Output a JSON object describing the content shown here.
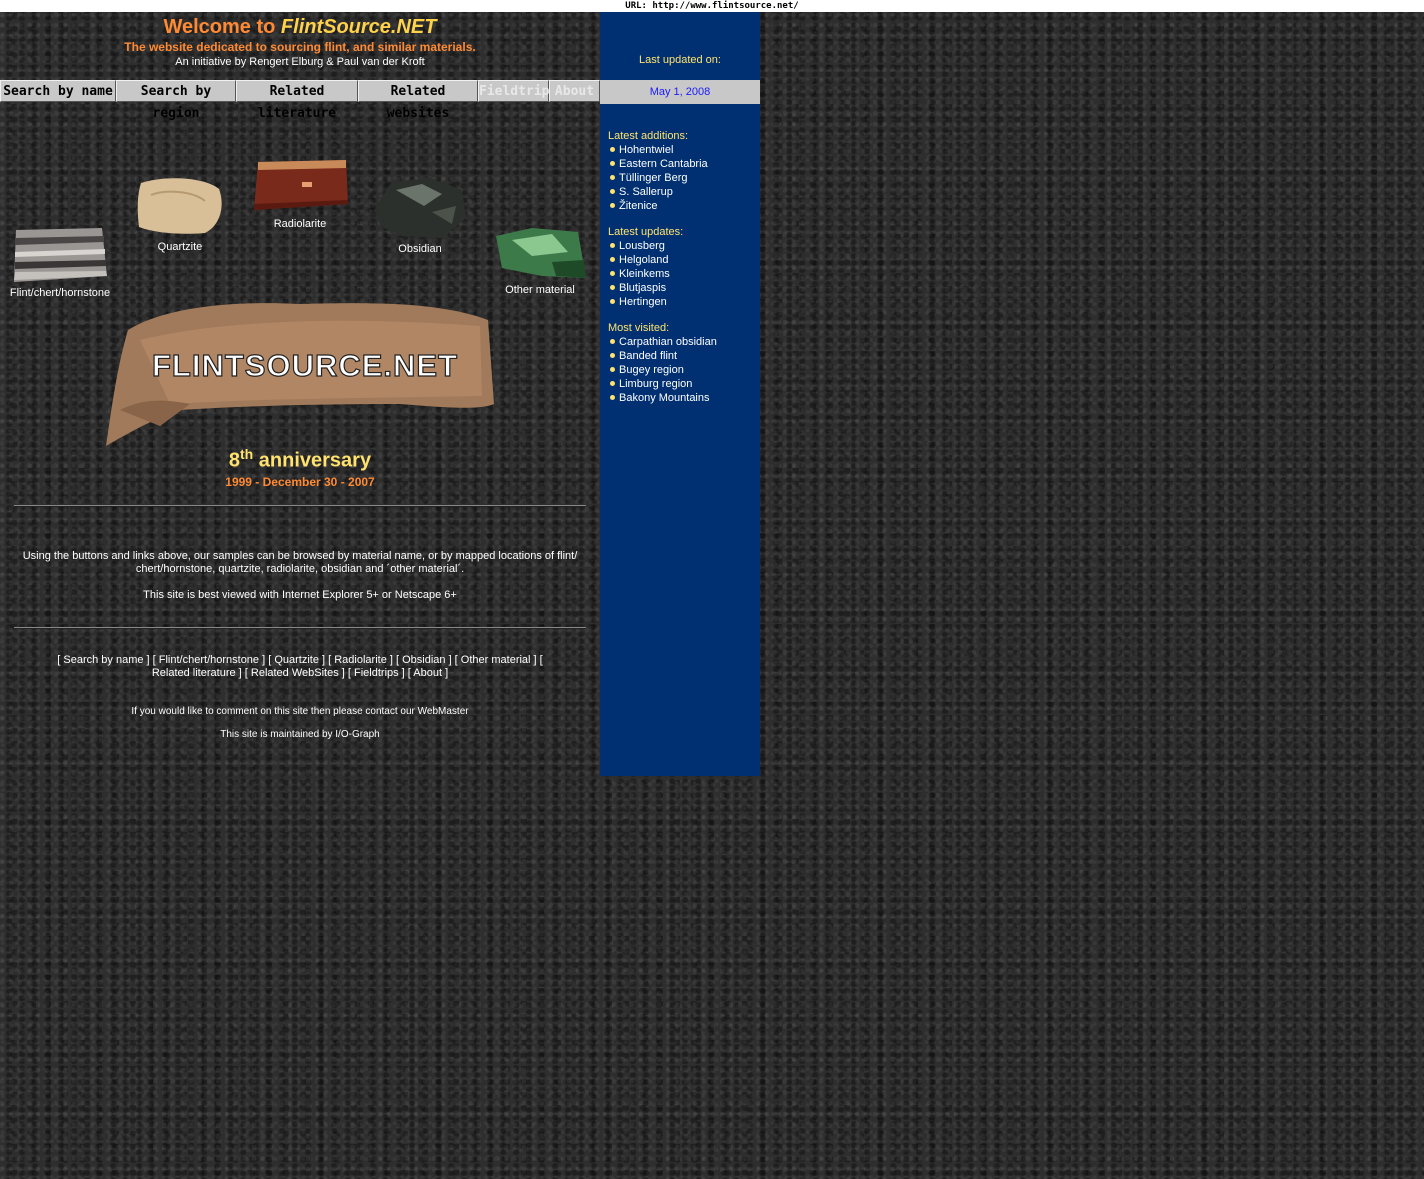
{
  "url_bar": "URL: http://www.flintsource.net/",
  "header": {
    "welcome_prefix": "Welcome to ",
    "welcome_brand": "FlintSource.NET",
    "subtitle": "The website dedicated to sourcing flint, and similar materials.",
    "initiative": "An initiative by Rengert Elburg & Paul van der Kroft"
  },
  "nav": {
    "buttons": [
      {
        "label": "Search by name"
      },
      {
        "label": "Search by region"
      },
      {
        "label": "Related literature"
      },
      {
        "label": "Related websites"
      },
      {
        "label": "Fieldtrips"
      },
      {
        "label": "About"
      }
    ]
  },
  "specimens": [
    {
      "label": "Flint/chert/hornstone"
    },
    {
      "label": "Quartzite"
    },
    {
      "label": "Radiolarite"
    },
    {
      "label": "Obsidian"
    },
    {
      "label": "Other material"
    }
  ],
  "logo": {
    "text": "FLINTSOURCE.NET"
  },
  "anniversary": {
    "number": "8",
    "suffix": "th",
    "word": " anniversary",
    "dates": "1999 - December 30 - 2007"
  },
  "info": {
    "browse_text": "Using the buttons and links above, our samples can be browsed by material name, or by mapped locations of flint/ chert/hornstone, quartzite, radiolarite, obsidian and ´other material´.",
    "best_viewed": "This site is best viewed with Internet Explorer 5+ or Netscape 6+"
  },
  "footer_links": {
    "line": "[ Search by name ] [ Flint/chert/hornstone ] [ Quartzite ] [ Radiolarite ] [ Obsidian ] [ Other material ] [ Related literature ] [ Related WebSites ] [ Fieldtrips ] [ About ]",
    "comment": "If you would like to comment on this site then please contact our WebMaster",
    "maintained": "This site is maintained by I/O-Graph"
  },
  "sidebar": {
    "last_updated_label": "Last updated on:",
    "last_updated_date": "May 1, 2008",
    "latest_additions_title": "Latest additions:",
    "latest_additions": [
      "Hohentwiel",
      "Eastern Cantabria",
      "Tüllinger Berg",
      "S. Sallerup",
      "Žitenice"
    ],
    "latest_updates_title": "Latest updates:",
    "latest_updates": [
      "Lousberg",
      "Helgoland",
      "Kleinkems",
      "Blutjaspis",
      "Hertingen"
    ],
    "most_visited_title": "Most visited:",
    "most_visited": [
      "Carpathian obsidian",
      "Banded flint",
      "Bugey region",
      "Limburg region",
      "Bakony Mountains"
    ]
  },
  "colors": {
    "sidebar_bg": "#003071",
    "accent_orange": "#ff8a33",
    "accent_yellow": "#ffe36e"
  }
}
